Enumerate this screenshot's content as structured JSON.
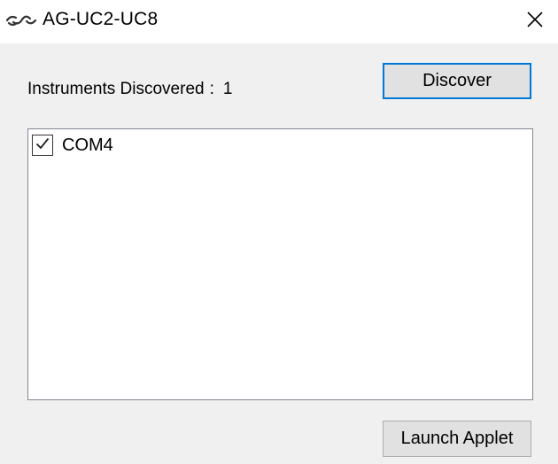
{
  "window": {
    "title": "AG-UC2-UC8",
    "app_icon": "link-chain-icon",
    "close_icon": "close-icon"
  },
  "discovery": {
    "label": "Instruments Discovered",
    "separator": ":",
    "count": "1",
    "discover_button": "Discover"
  },
  "instruments": [
    {
      "label": "COM4",
      "checked": true
    }
  ],
  "footer": {
    "launch_button": "Launch Applet"
  },
  "colors": {
    "accent": "#0078d7",
    "window_bg": "#f0f0f0",
    "titlebar_bg": "#ffffff",
    "button_bg": "#e1e1e1"
  }
}
